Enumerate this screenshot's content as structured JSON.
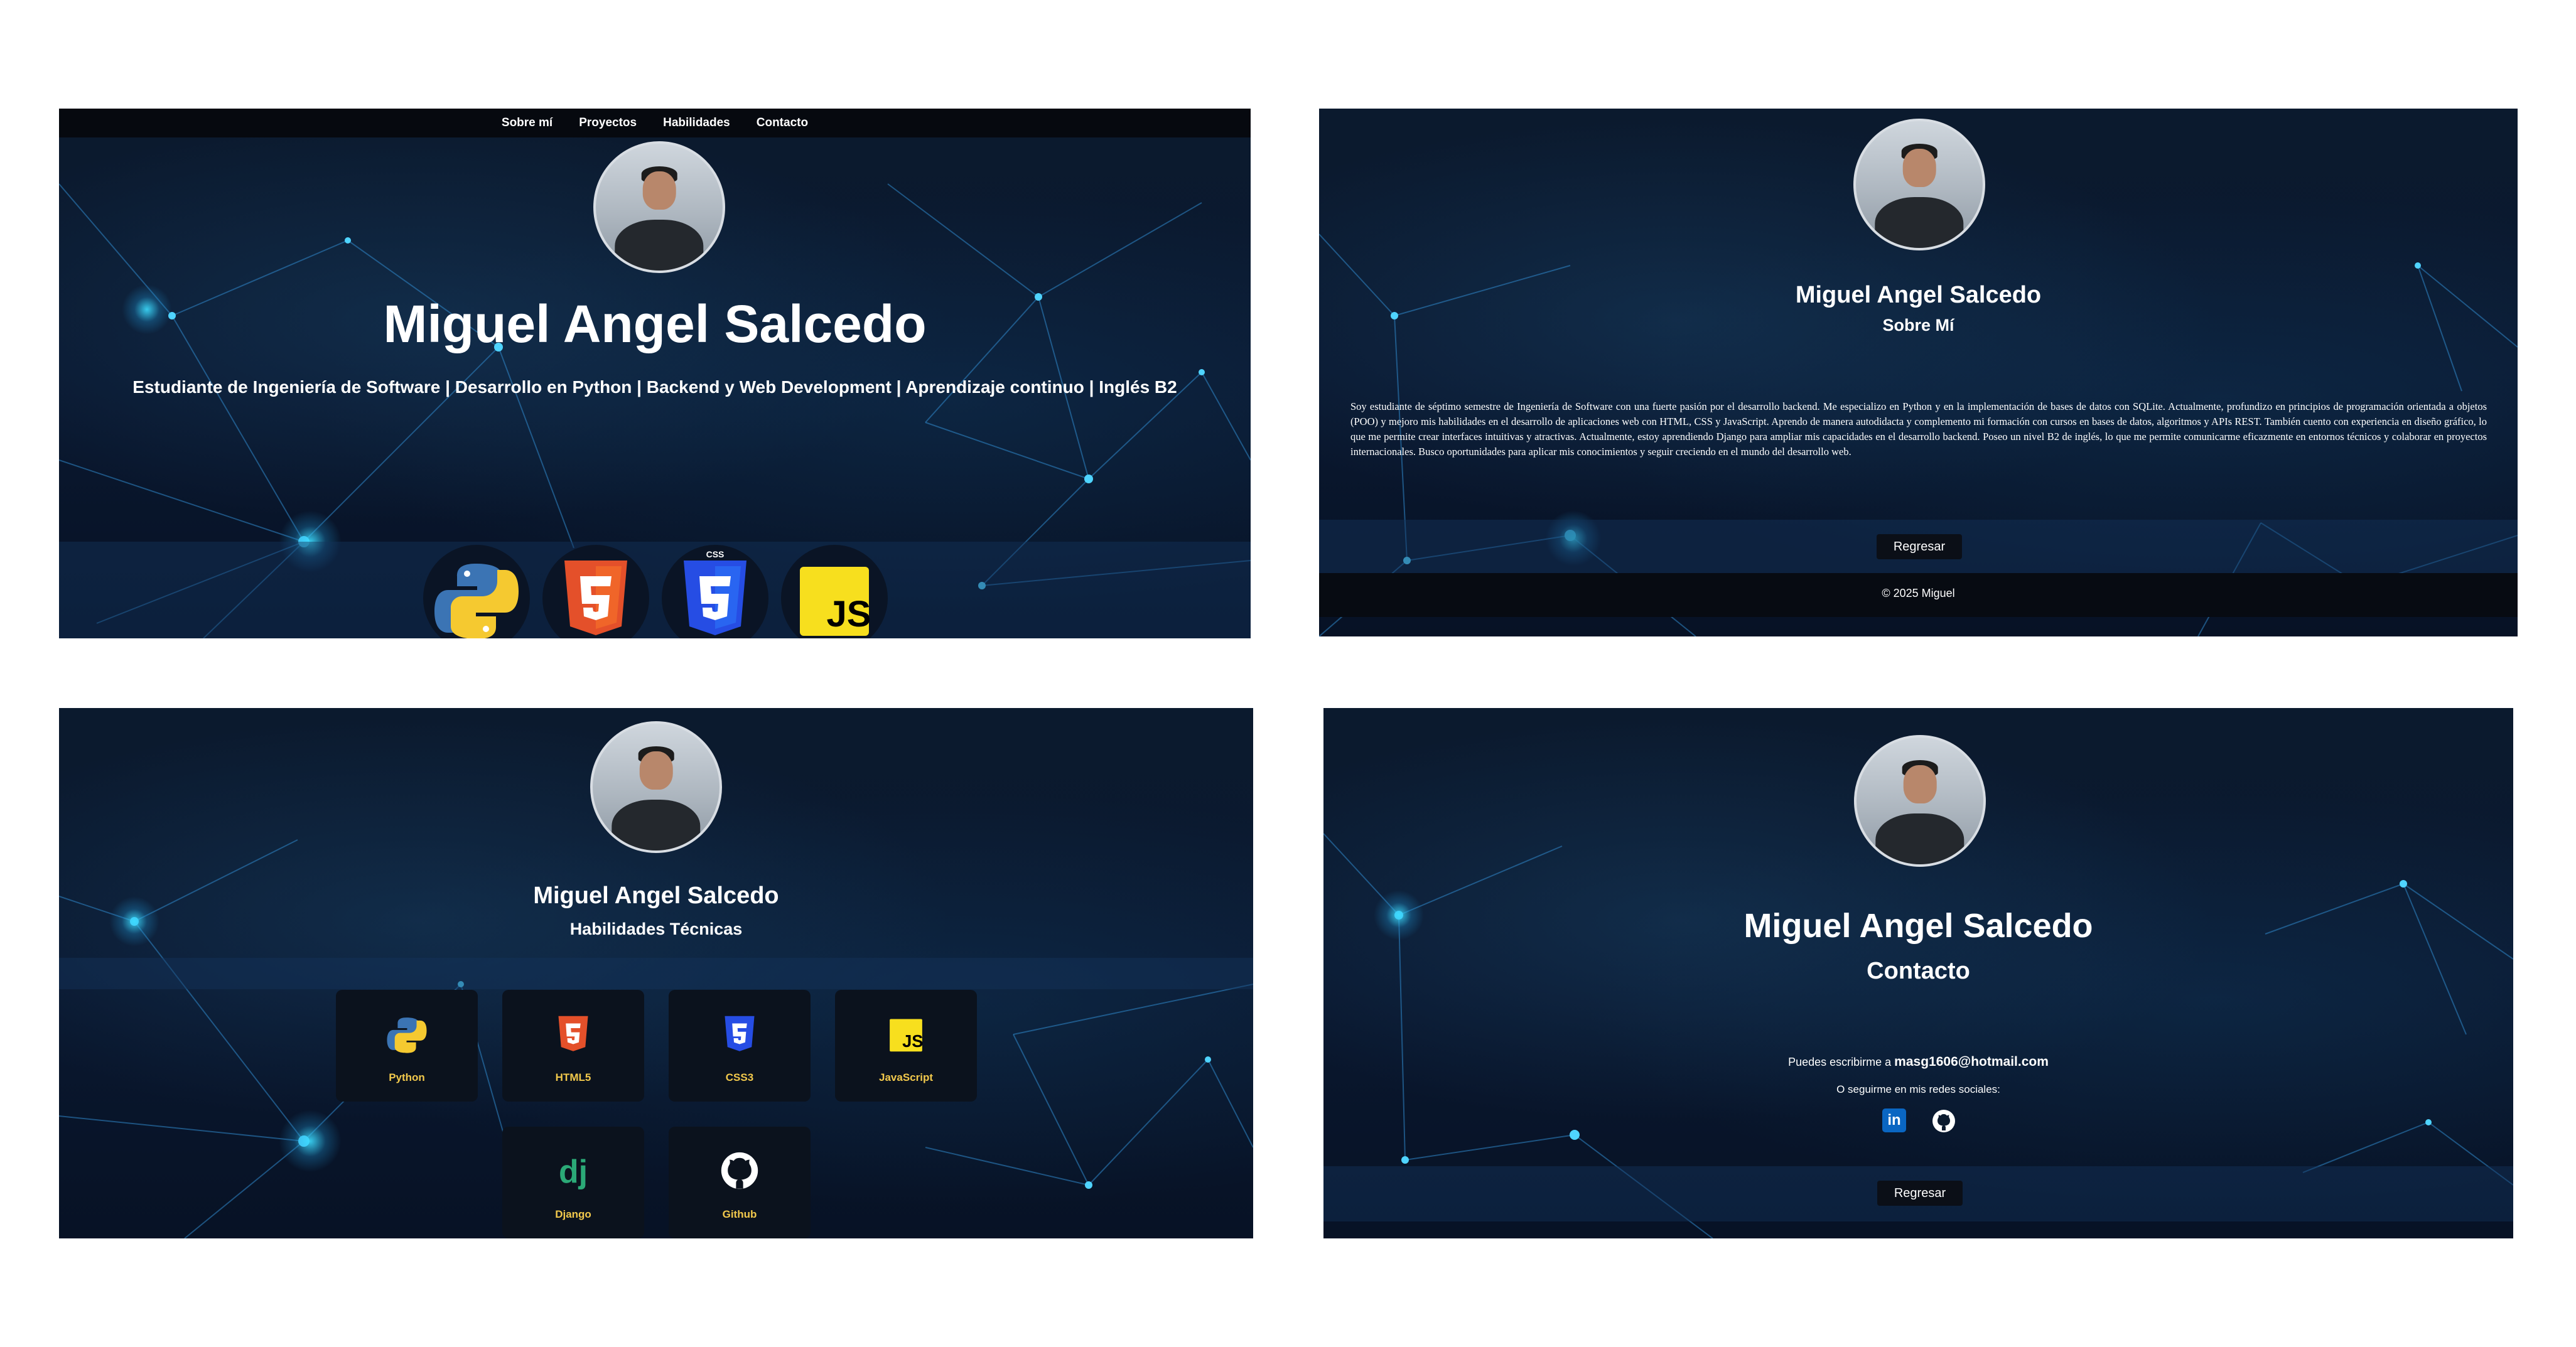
{
  "nav": {
    "items": [
      "Sobre mí",
      "Proyectos",
      "Habilidades",
      "Contacto"
    ]
  },
  "home": {
    "name": "Miguel Angel Salcedo",
    "tagline": "Estudiante de Ingeniería de Software | Desarrollo en Python | Backend y Web Development | Aprendizaje continuo | Inglés B2",
    "tech_icons": [
      "python-icon",
      "html5-icon",
      "css3-icon",
      "javascript-icon"
    ]
  },
  "about": {
    "name": "Miguel Angel Salcedo",
    "section": "Sobre Mí",
    "paragraph": "Soy estudiante de séptimo semestre de Ingeniería de Software con una fuerte pasión por el desarrollo backend. Me especializo en Python y en la implementación de bases de datos con SQLite. Actualmente, profundizo en principios de programación orientada a objetos (POO) y mejoro mis habilidades en el desarrollo de aplicaciones web con HTML, CSS y JavaScript. Aprendo de manera autodidacta y complemento mi formación con cursos en bases de datos, algoritmos y APIs REST. También cuento con experiencia en diseño gráfico, lo que me permite crear interfaces intuitivas y atractivas. Actualmente, estoy aprendiendo Django para ampliar mis capacidades en el desarrollo backend. Poseo un nivel B2 de inglés, lo que me permite comunicarme eficazmente en entornos técnicos y colaborar en proyectos internacionales. Busco oportunidades para aplicar mis conocimientos y seguir creciendo en el mundo del desarrollo web.",
    "back_button": "Regresar",
    "footer": "© 2025 Miguel"
  },
  "skills": {
    "name": "Miguel Angel Salcedo",
    "section": "Habilidades Técnicas",
    "items": [
      {
        "label": "Python",
        "icon": "python-icon"
      },
      {
        "label": "HTML5",
        "icon": "html5-icon"
      },
      {
        "label": "CSS3",
        "icon": "css3-icon"
      },
      {
        "label": "JavaScript",
        "icon": "javascript-icon"
      },
      {
        "label": "Django",
        "icon": "django-icon"
      },
      {
        "label": "Github",
        "icon": "github-icon"
      }
    ],
    "label_color": "#f2c94c"
  },
  "contact": {
    "name": "Miguel Angel Salcedo",
    "section": "Contacto",
    "email_prefix": "Puedes escribirme a",
    "email": "masg1606@hotmail.com",
    "social_text": "O seguirme en mis redes sociales:",
    "social_icons": [
      "linkedin-icon",
      "github-icon"
    ],
    "back_button": "Regresar"
  },
  "colors": {
    "background": "#0a1830",
    "nav": "#06090f",
    "accent": "#4fd4ff",
    "button": "#0b0f17"
  }
}
